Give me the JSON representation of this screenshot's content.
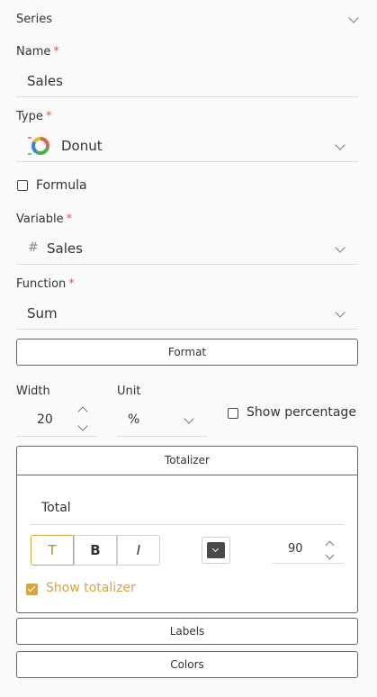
{
  "series": {
    "title": "Series"
  },
  "name": {
    "label": "Name",
    "required": "*",
    "value": "Sales"
  },
  "type": {
    "label": "Type",
    "required": "*",
    "value": "Donut",
    "icon": "donut-chart-icon"
  },
  "formula": {
    "label": "Formula",
    "checked": false
  },
  "variable": {
    "label": "Variable",
    "required": "*",
    "value": "Sales",
    "icon": "hash-icon",
    "icon_glyph": "#"
  },
  "function": {
    "label": "Function",
    "required": "*",
    "value": "Sum"
  },
  "format": {
    "label": "Format"
  },
  "width": {
    "label": "Width",
    "value": "20"
  },
  "unit": {
    "label": "Unit",
    "value": "%"
  },
  "show_percentage": {
    "label": "Show percentage",
    "checked": false
  },
  "totalizer": {
    "label": "Totalizer",
    "text_value": "Total",
    "style_buttons": [
      {
        "glyph": "T",
        "name": "text-style-button",
        "active": true
      },
      {
        "glyph": "B",
        "name": "bold-button",
        "active": false
      },
      {
        "glyph": "I",
        "name": "italic-button",
        "active": false
      }
    ],
    "color": "#4a4a4a",
    "font_size": "90",
    "show_totalizer": {
      "label": "Show totalizer",
      "checked": true
    }
  },
  "labels": {
    "label": "Labels"
  },
  "colors": {
    "label": "Colors"
  },
  "theme": {
    "accent": "#d6a640",
    "required": "#e05a4f"
  }
}
